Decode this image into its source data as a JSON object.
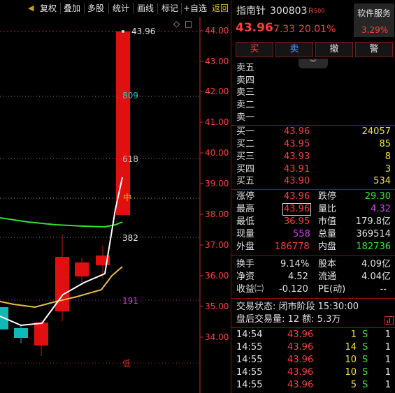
{
  "toolbar": {
    "arrow": "◀",
    "items": [
      "复权",
      "叠加",
      "多股",
      "统计",
      "画线",
      "标记",
      "+自选",
      "返回"
    ]
  },
  "chart": {
    "price_labels": [
      "44.00",
      "43.00",
      "42.00",
      "41.00",
      "40.00",
      "39.00",
      "38.00",
      "37.00",
      "36.00",
      "35.00",
      "34.00"
    ],
    "fib_labels": {
      "top": "43.96",
      "f809": "809",
      "f618": "618",
      "mid": "中",
      "f382": "382",
      "f191": "191",
      "low": "低"
    },
    "tool_icons": [
      "◇",
      "□"
    ],
    "colors": {
      "up": "#e01010",
      "down": "#10c0c0",
      "ma5": "#ffffff",
      "ma10": "#e8c040",
      "ma20": "#30e030",
      "axis": "#c03030"
    }
  },
  "stock": {
    "name": "指南针",
    "code": "300803",
    "badge": "R",
    "badge_sub": "500",
    "price": "43.96",
    "change": "7.33",
    "pct": "20.01%",
    "sector": "软件服务",
    "sector_pct": "3.29%"
  },
  "actions": {
    "buy": "买",
    "sell": "卖",
    "cancel": "撤",
    "alert": "警"
  },
  "sell_levels": [
    "卖五",
    "卖四",
    "卖三",
    "卖二",
    "卖一"
  ],
  "buy_levels": [
    {
      "label": "买一",
      "price": "43.96",
      "vol": "24057"
    },
    {
      "label": "买二",
      "price": "43.95",
      "vol": "85"
    },
    {
      "label": "买三",
      "price": "43.93",
      "vol": "8"
    },
    {
      "label": "买四",
      "price": "43.91",
      "vol": "3"
    },
    {
      "label": "买五",
      "price": "43.90",
      "vol": "534"
    }
  ],
  "stats1": [
    {
      "l1": "涨停",
      "v1": "43.96",
      "l2": "跌停",
      "v2": "29.30"
    },
    {
      "l1": "最高",
      "v1": "43.96",
      "l2": "量比",
      "v2": "4.32"
    },
    {
      "l1": "最低",
      "v1": "36.95",
      "l2": "市值",
      "v2": "179.8亿"
    },
    {
      "l1": "现量",
      "v1": "558",
      "l2": "总量",
      "v2": "369514"
    },
    {
      "l1": "外盘",
      "v1": "186778",
      "l2": "内盘",
      "v2": "182736"
    }
  ],
  "stats2": [
    {
      "l1": "换手",
      "v1": "9.14%",
      "l2": "股本",
      "v2": "4.09亿"
    },
    {
      "l1": "净资",
      "v1": "4.52",
      "l2": "流通",
      "v2": "4.04亿"
    },
    {
      "l1": "收益㈡",
      "v1": "-0.120",
      "l2": "PE(动)",
      "v2": "--"
    }
  ],
  "status": {
    "trade_state": "交易状态: 闭市阶段 15:30:00",
    "after_hours": "盘后交易量: 12  额: 5.3万"
  },
  "ticks": [
    {
      "time": "14:54",
      "price": "43.96",
      "vol": "1",
      "side": "S",
      "n": "1"
    },
    {
      "time": "14:55",
      "price": "43.96",
      "vol": "14",
      "side": "S",
      "n": "1"
    },
    {
      "time": "14:55",
      "price": "43.96",
      "vol": "10",
      "side": "S",
      "n": "1"
    },
    {
      "time": "14:55",
      "price": "43.96",
      "vol": "10",
      "side": "S",
      "n": "1"
    },
    {
      "time": "14:55",
      "price": "43.96",
      "vol": "5",
      "side": "S",
      "n": "1"
    }
  ]
}
